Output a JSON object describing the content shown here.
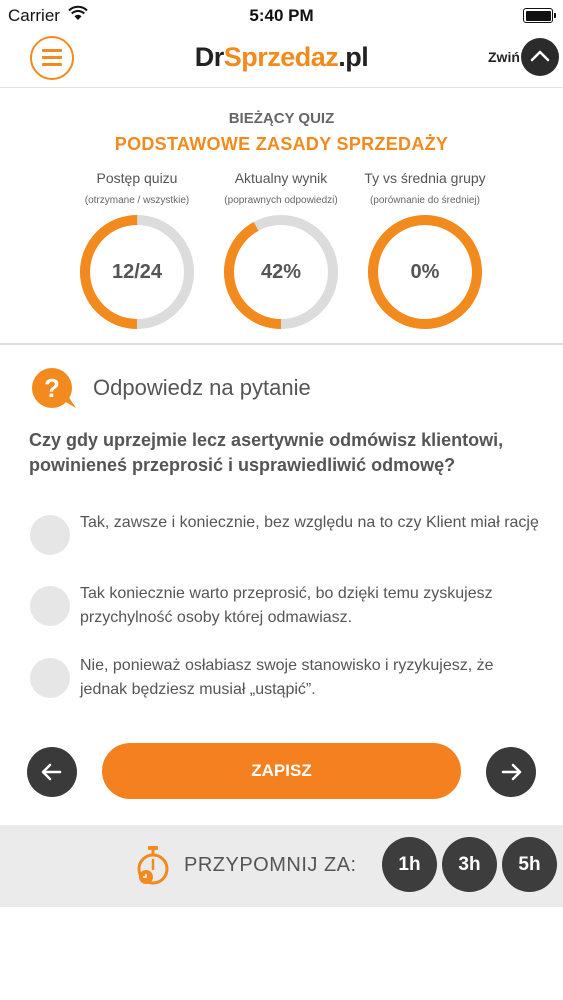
{
  "status_bar": {
    "carrier": "Carrier",
    "time": "5:40 PM"
  },
  "header": {
    "logo_dr": "Dr",
    "logo_sprzedaz": "Sprzedaz",
    "logo_pl": ".pl",
    "collapse_label": "Zwiń"
  },
  "quiz": {
    "label": "BIEŻĄCY QUIZ",
    "title": "PODSTAWOWE ZASADY SPRZEDAŻY",
    "stats": [
      {
        "title": "Postęp quizu",
        "subtitle": "(otrzymane / wszystkie)",
        "value": "12/24",
        "progress": 0.5
      },
      {
        "title": "Aktualny wynik",
        "subtitle": "(poprawnych odpowiedzi)",
        "value": "42%",
        "progress": 0.42
      },
      {
        "title": "Ty vs średnia grupy",
        "subtitle": "(porównanie do średniej)",
        "value": "0%",
        "progress": 1.0
      }
    ]
  },
  "question": {
    "heading": "Odpowiedz na pytanie",
    "text": "Czy gdy uprzejmie lecz asertywnie odmówisz klientowi, powinieneś przeprosić i usprawiedliwić odmowę?",
    "options": [
      "Tak, zawsze i koniecznie, bez względu na to czy Klient miał rację",
      "Tak koniecznie warto przeprosić, bo dzięki temu zyskujesz przychylność osoby której odmawiasz.",
      "Nie, ponieważ osłabiasz swoje stanowisko i ryzykujesz, że jednak będziesz musiał „ustąpić”."
    ]
  },
  "actions": {
    "save_label": "ZAPISZ"
  },
  "reminder": {
    "label": "PRZYPOMNIJ ZA:",
    "options": [
      "1h",
      "3h",
      "5h"
    ]
  },
  "colors": {
    "accent": "#f28a1e",
    "ring_track": "#dcdcdc",
    "dark_button": "#3a3a3a",
    "radio": "#e6e6e6"
  }
}
